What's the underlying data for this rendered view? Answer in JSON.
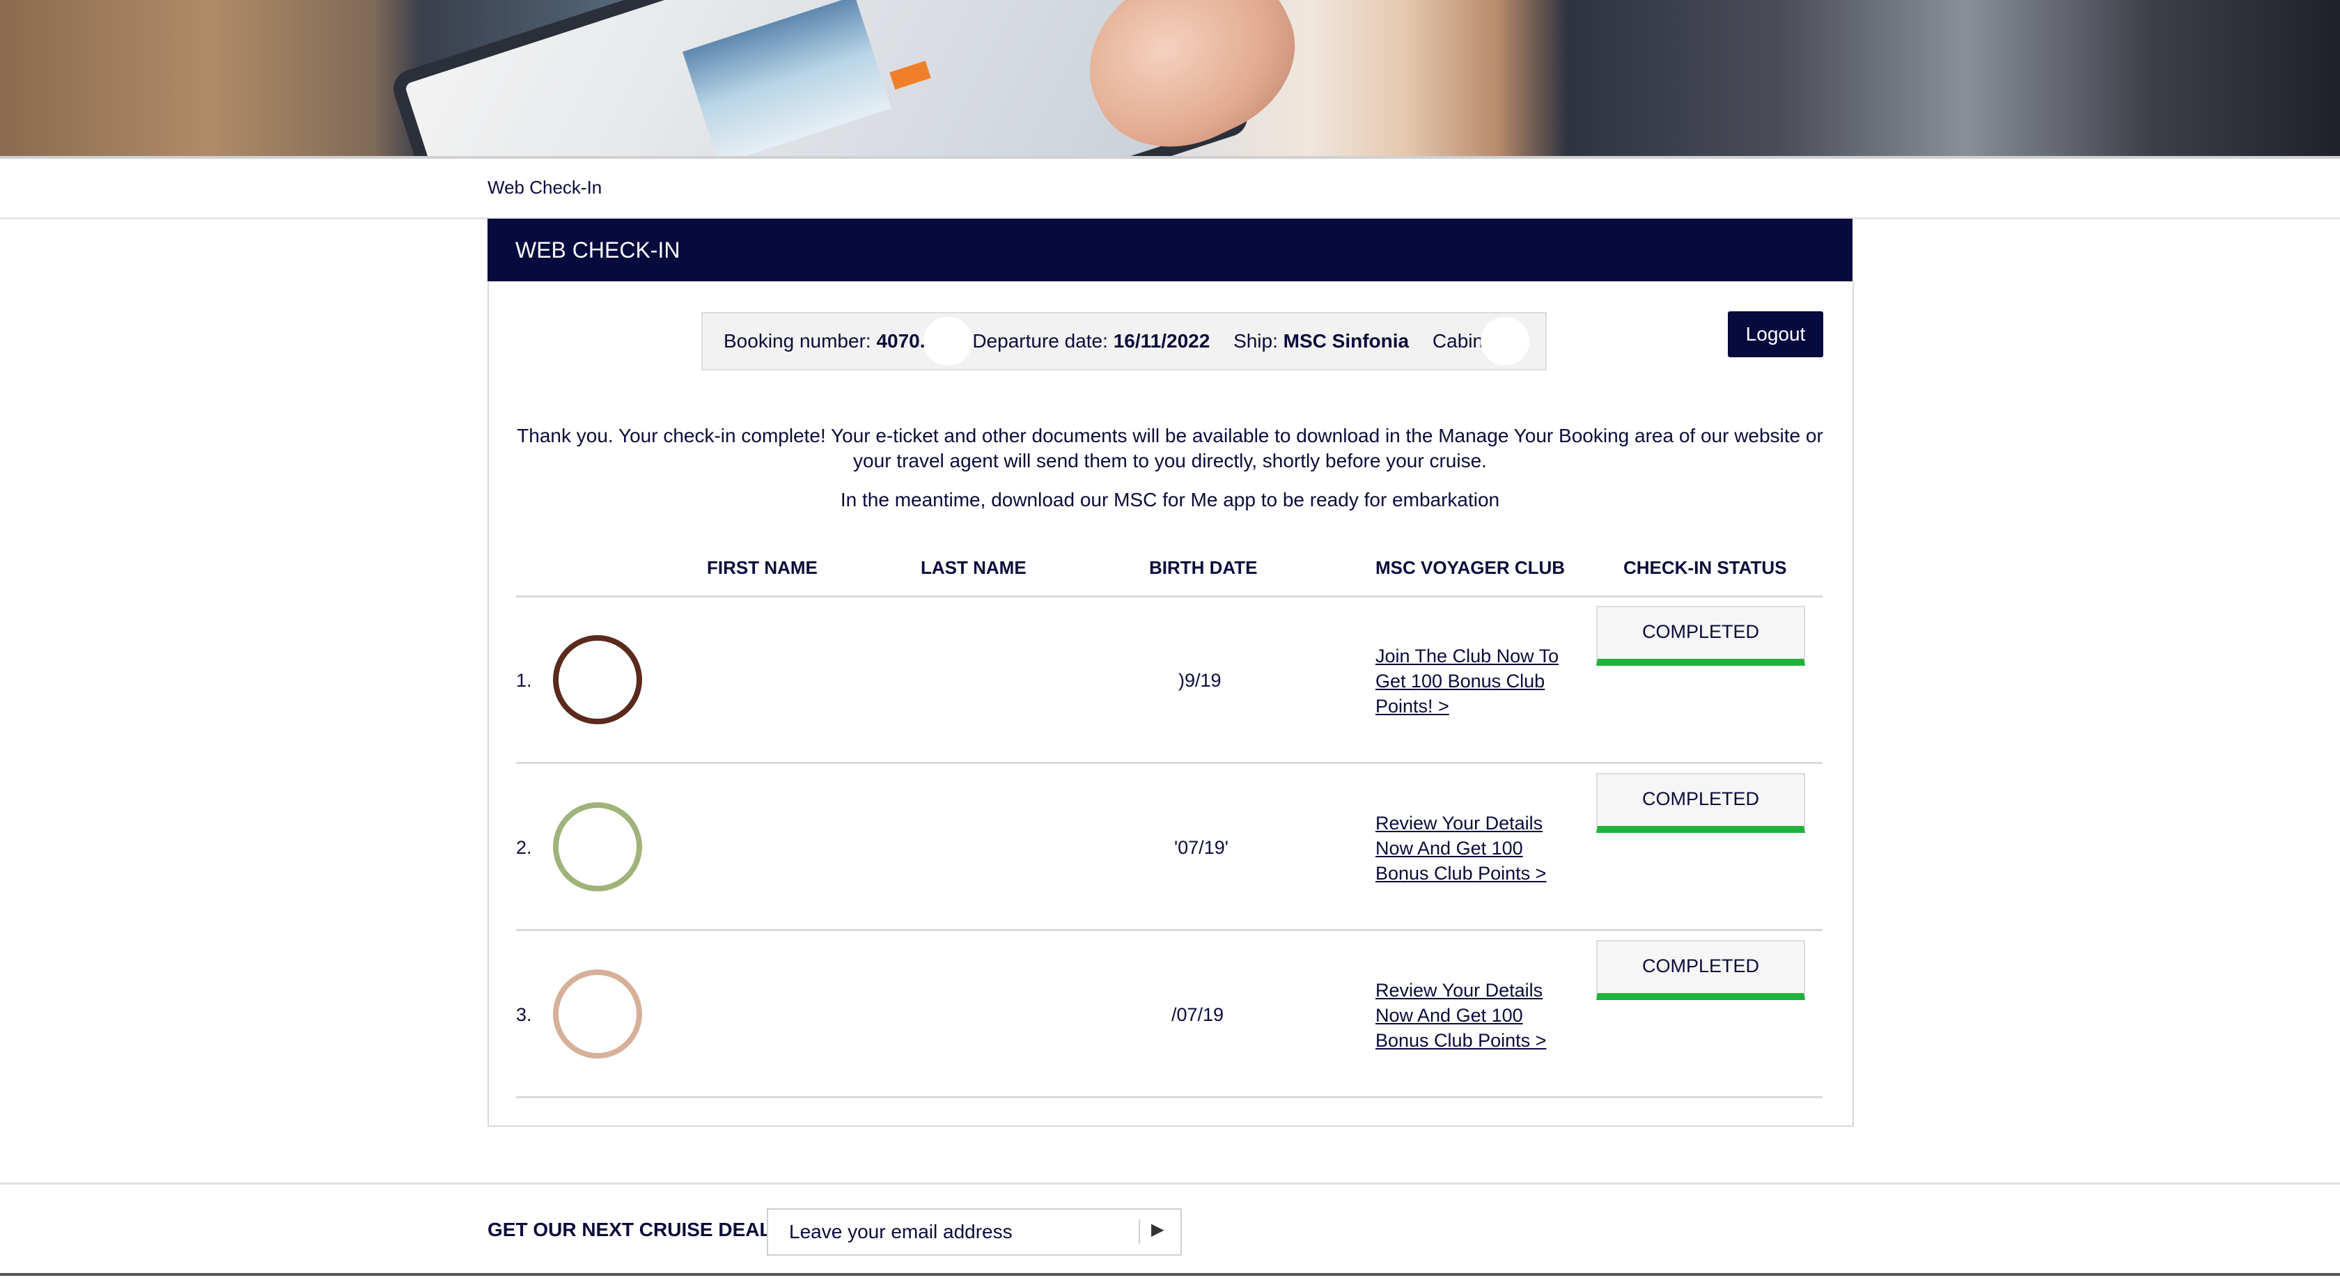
{
  "breadcrumb": "Web Check-In",
  "card_title": "WEB CHECK-IN",
  "booking": {
    "booking_label": "Booking number:",
    "booking_value": "4070.",
    "departure_label": "Departure date:",
    "departure_value": "16/11/2022",
    "ship_label": "Ship:",
    "ship_value": "MSC Sinfonia",
    "cabin_label": "Cabin:"
  },
  "logout_label": "Logout",
  "message_line1": "Thank you. Your check-in complete! Your e-ticket and other documents will be available to download in the Manage Your Booking area of our website or",
  "message_line2": "your travel agent will send them to you directly, shortly before your cruise.",
  "message_line3": "In the meantime, download our MSC for Me app to be ready for embarkation",
  "table": {
    "headers": {
      "first_name": "FIRST NAME",
      "last_name": "LAST NAME",
      "birth_date": "BIRTH DATE",
      "club": "MSC VOYAGER CLUB",
      "status": "CHECK-IN STATUS"
    },
    "rows": [
      {
        "num": "1.",
        "birth": ")9/19",
        "club": "Join The Club Now To Get 100 Bonus Club Points! >",
        "status": "COMPLETED",
        "avatar_color": "#5a2a1c"
      },
      {
        "num": "2.",
        "birth": "'07/19'",
        "club": "Review Your Details Now And Get 100 Bonus Club Points >",
        "status": "COMPLETED",
        "avatar_color": "#7fa25a"
      },
      {
        "num": "3.",
        "birth": "/07/19",
        "club": "Review Your Details Now And Get 100 Bonus Club Points >",
        "status": "COMPLETED",
        "avatar_color": "#d79a7a"
      }
    ]
  },
  "footer": {
    "deals_label": "GET OUR NEXT CRUISE DEALS",
    "email_placeholder": "Leave your email address"
  },
  "colors": {
    "navy": "#070a3d",
    "status_green": "#1eb33a"
  }
}
